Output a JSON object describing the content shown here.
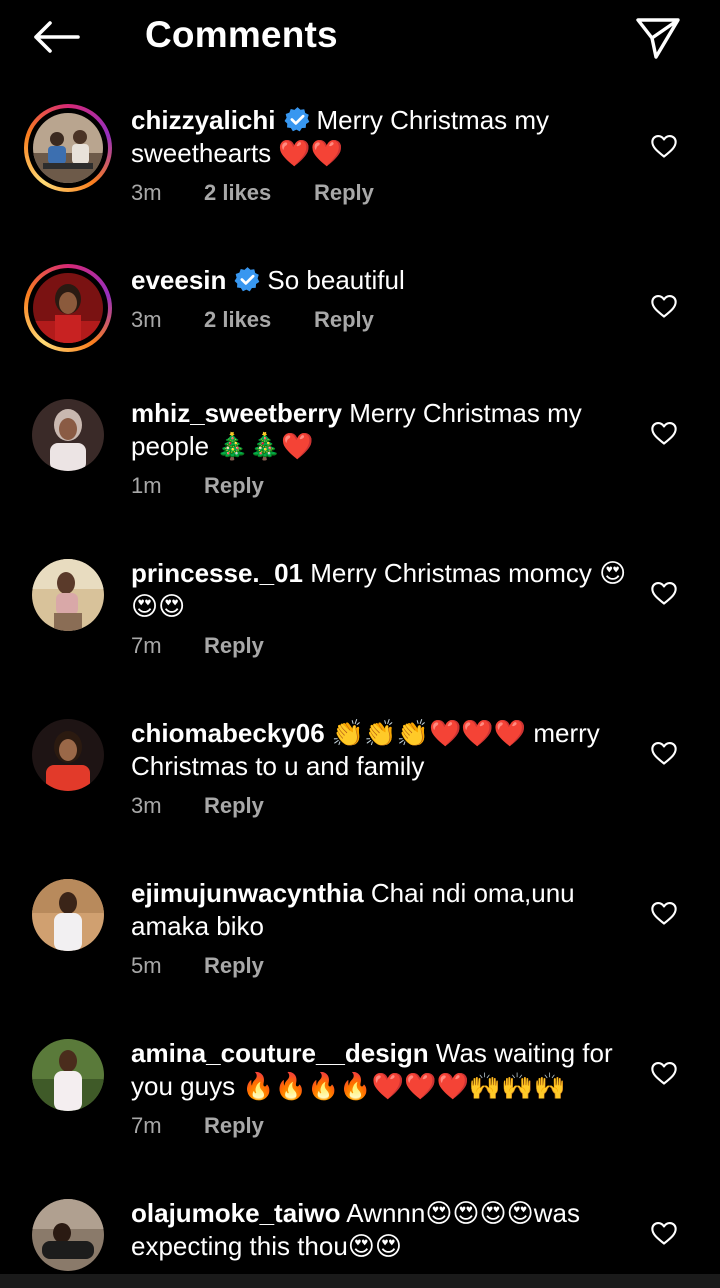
{
  "header": {
    "title": "Comments",
    "back_icon": "arrow-left-icon",
    "share_icon": "send-paper-plane-icon"
  },
  "colors": {
    "background": "#000000",
    "text": "#ffffff",
    "meta_text": "#a8a8a8",
    "verified_badge": "#3897f0"
  },
  "comments": [
    {
      "username": "chizzyalichi",
      "verified": true,
      "has_story": true,
      "text": "Merry Christmas my sweethearts ❤️❤️",
      "time": "3m",
      "likes": "2 likes",
      "reply": "Reply"
    },
    {
      "username": "eveesin",
      "verified": true,
      "has_story": true,
      "text": "So beautiful",
      "time": "3m",
      "likes": "2 likes",
      "reply": "Reply"
    },
    {
      "username": "mhiz_sweetberry",
      "verified": false,
      "has_story": false,
      "text": "Merry Christmas my people 🎄🎄❤️",
      "time": "1m",
      "likes": "",
      "reply": "Reply"
    },
    {
      "username": "princesse._01",
      "verified": false,
      "has_story": false,
      "text": "Merry Christmas momcy 😍😍😍",
      "time": "7m",
      "likes": "",
      "reply": "Reply"
    },
    {
      "username": "chiomabecky06",
      "verified": false,
      "has_story": false,
      "text": "👏👏👏❤️❤️❤️ merry Christmas to u and family",
      "time": "3m",
      "likes": "",
      "reply": "Reply"
    },
    {
      "username": "ejimujunwacynthia",
      "verified": false,
      "has_story": false,
      "text": "Chai ndi oma,unu amaka biko",
      "time": "5m",
      "likes": "",
      "reply": "Reply"
    },
    {
      "username": "amina_couture__design",
      "verified": false,
      "has_story": false,
      "text": "Was waiting for you guys 🔥🔥🔥🔥❤️❤️❤️🙌🙌🙌",
      "time": "7m",
      "likes": "",
      "reply": "Reply"
    },
    {
      "username": "olajumoke_taiwo",
      "verified": false,
      "has_story": false,
      "text": "Awnnn😍😍😍😍was expecting this thou😍😍",
      "time": "",
      "likes": "",
      "reply": ""
    }
  ]
}
